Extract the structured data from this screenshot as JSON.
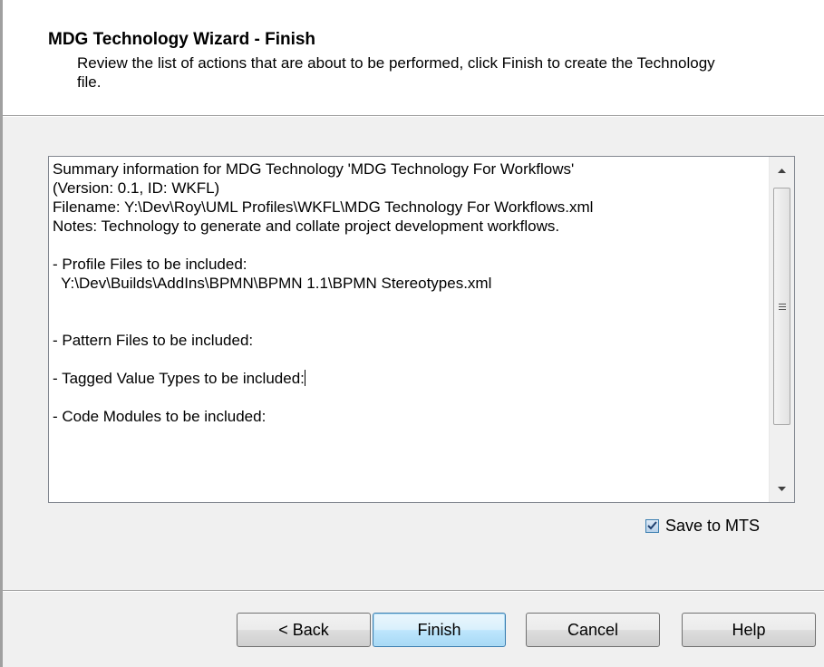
{
  "header": {
    "title": "MDG Technology Wizard - Finish",
    "description": "Review the list of actions that are about to be performed, click Finish to create the Technology file."
  },
  "summary": {
    "text_before_caret": "Summary information for MDG Technology 'MDG Technology For Workflows'\n(Version: 0.1, ID: WKFL)\nFilename: Y:\\Dev\\Roy\\UML Profiles\\WKFL\\MDG Technology For Workflows.xml\nNotes: Technology to generate and collate project development workflows.\n\n- Profile Files to be included:\n  Y:\\Dev\\Builds\\AddIns\\BPMN\\BPMN 1.1\\BPMN Stereotypes.xml\n\n\n- Pattern Files to be included:\n\n- Tagged Value Types to be included:",
    "text_after_caret": "\n\n- Code Modules to be included:"
  },
  "save_to_mts": {
    "label": "Save to MTS",
    "checked": true
  },
  "buttons": {
    "back": "< Back",
    "finish": "Finish",
    "cancel": "Cancel",
    "help": "Help"
  },
  "icons": {
    "scroll_up": "scroll-up-arrow-icon",
    "scroll_down": "scroll-down-arrow-icon",
    "check": "checkmark-icon"
  },
  "colors": {
    "header_bg": "#ffffff",
    "dialog_bg": "#f0f0f0",
    "default_button_border": "#3c7fb1"
  }
}
